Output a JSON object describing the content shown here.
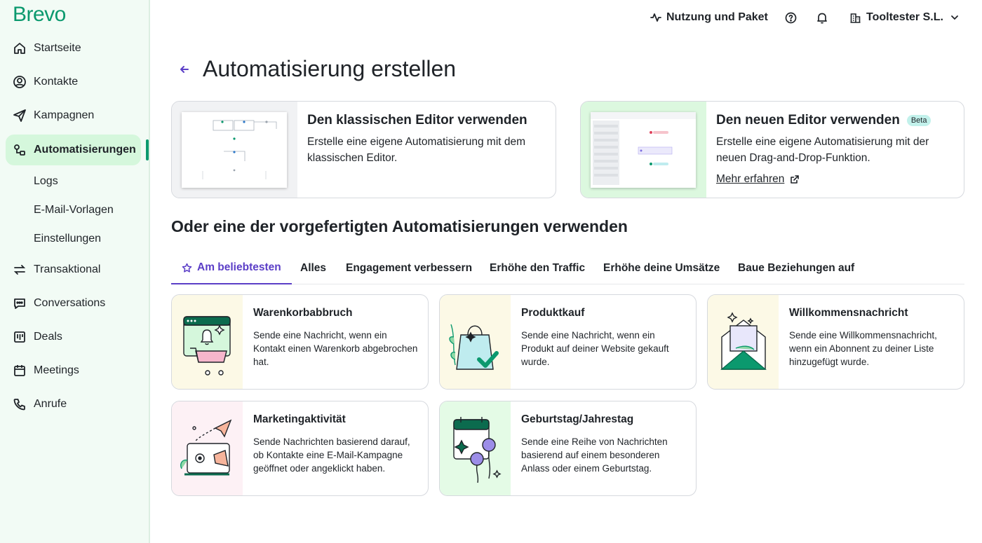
{
  "app": {
    "logo": "Brevo"
  },
  "sidebar": {
    "items": [
      {
        "label": "Startseite",
        "icon": "home-icon"
      },
      {
        "label": "Kontakte",
        "icon": "contact-icon"
      },
      {
        "label": "Kampagnen",
        "icon": "send-icon"
      },
      {
        "label": "Automatisierungen",
        "icon": "automation-icon"
      },
      {
        "label": "Transaktional",
        "icon": "transactional-icon"
      },
      {
        "label": "Conversations",
        "icon": "chat-icon"
      },
      {
        "label": "Deals",
        "icon": "deals-icon"
      },
      {
        "label": "Meetings",
        "icon": "calendar-icon"
      },
      {
        "label": "Anrufe",
        "icon": "phone-icon"
      }
    ],
    "subitems": [
      {
        "label": "Logs"
      },
      {
        "label": "E-Mail-Vorlagen"
      },
      {
        "label": "Einstellungen"
      }
    ]
  },
  "topbar": {
    "usage_label": "Nutzung und Paket",
    "account_label": "Tooltester S.L."
  },
  "page": {
    "title": "Automatisierung erstellen"
  },
  "editors": [
    {
      "title": "Den klassischen Editor verwenden",
      "description": "Erstelle eine eigene Automatisierung mit dem klassischen Editor."
    },
    {
      "title": "Den neuen Editor verwenden",
      "badge": "Beta",
      "description": "Erstelle eine eigene Automatisierung mit der neuen Drag-and-Drop-Funktion.",
      "link": "Mehr erfahren"
    }
  ],
  "section": {
    "title": "Oder eine der vorgefertigten Automatisierungen verwenden"
  },
  "tabs": [
    {
      "label": "Am beliebtesten"
    },
    {
      "label": "Alles"
    },
    {
      "label": "Engagement verbessern"
    },
    {
      "label": "Erhöhe den Traffic"
    },
    {
      "label": "Erhöhe deine Umsätze"
    },
    {
      "label": "Baue Beziehungen auf"
    }
  ],
  "templates": [
    {
      "title": "Warenkorbabbruch",
      "description": "Sende eine Nachricht, wenn ein Kontakt einen Warenkorb abgebrochen hat.",
      "icon": "cart-illustration"
    },
    {
      "title": "Produktkauf",
      "description": "Sende eine Nachricht, wenn ein Produkt auf deiner Website gekauft wurde.",
      "icon": "shopping-bag-illustration"
    },
    {
      "title": "Willkommensnachricht",
      "description": "Sende eine Willkommensnachricht, wenn ein Abonnent zu deiner Liste hinzugefügt wurde.",
      "icon": "envelope-illustration"
    },
    {
      "title": "Marketingaktivität",
      "description": "Sende Nachrichten basierend darauf, ob Kontakte eine E-Mail-Kampagne geöffnet oder angeklickt haben.",
      "icon": "marketing-illustration"
    },
    {
      "title": "Geburtstag/Jahrestag",
      "description": "Sende eine Reihe von Nachrichten basierend auf einem besonderen Anlass oder einem Geburtstag.",
      "icon": "birthday-illustration"
    }
  ],
  "colors": {
    "brand": "#0b996e",
    "accent": "#5b3ec7",
    "sidebar_bg": "#f2fbf5",
    "active_item": "#d5f7dc"
  }
}
